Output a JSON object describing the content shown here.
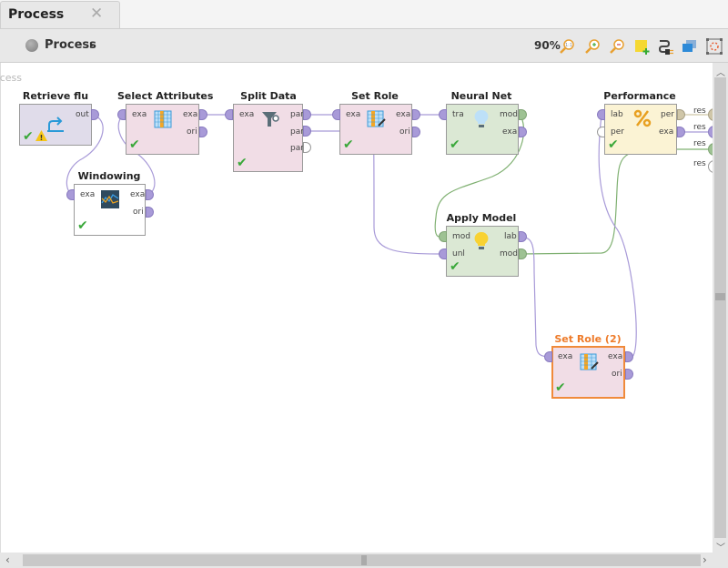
{
  "tab": {
    "label": "Process",
    "close_icon": "close-icon"
  },
  "toolbar": {
    "breadcrumb_icon": "process-icon",
    "breadcrumb_label": "Process",
    "breadcrumb_arrow": "▸",
    "zoom_level": "90%",
    "icons": [
      "zoom-reset-icon",
      "zoom-in-icon",
      "zoom-out-icon",
      "add-note-icon",
      "auto-wire-icon",
      "layers-icon",
      "auto-fit-icon"
    ]
  },
  "canvas": {
    "label": "Process"
  },
  "operators": [
    {
      "id": "retrieve",
      "title": "Retrieve flu",
      "color": "purple-gray",
      "inputs": [],
      "outputs": [
        "out"
      ],
      "status": "ok",
      "warning": true
    },
    {
      "id": "select",
      "title": "Select Attributes",
      "color": "pink",
      "inputs": [
        "exa"
      ],
      "outputs": [
        "exa",
        "ori"
      ],
      "status": "ok"
    },
    {
      "id": "split",
      "title": "Split Data",
      "color": "pink",
      "inputs": [
        "exa"
      ],
      "outputs": [
        "par",
        "par",
        "par"
      ],
      "status": "ok"
    },
    {
      "id": "setrole",
      "title": "Set Role",
      "color": "pink",
      "inputs": [
        "exa"
      ],
      "outputs": [
        "exa",
        "ori"
      ],
      "status": "ok"
    },
    {
      "id": "neural",
      "title": "Neural Net",
      "color": "green",
      "inputs": [
        "tra"
      ],
      "outputs": [
        "mod",
        "exa"
      ],
      "status": "ok"
    },
    {
      "id": "performance",
      "title": "Performance",
      "color": "yellow",
      "inputs": [
        "lab",
        "per"
      ],
      "outputs": [
        "per",
        "exa"
      ],
      "status": "ok"
    },
    {
      "id": "windowing",
      "title": "Windowing",
      "color": "white",
      "inputs": [
        "exa"
      ],
      "outputs": [
        "exa",
        "ori"
      ],
      "status": "ok"
    },
    {
      "id": "apply",
      "title": "Apply Model",
      "color": "green",
      "inputs": [
        "mod",
        "unl"
      ],
      "outputs": [
        "lab",
        "mod"
      ],
      "status": "ok"
    },
    {
      "id": "setrole2",
      "title": "Set Role (2)",
      "color": "pink",
      "inputs": [
        "exa"
      ],
      "outputs": [
        "exa",
        "ori"
      ],
      "status": "ok",
      "selected": true
    }
  ],
  "result_ports": [
    "res",
    "res",
    "res",
    "res"
  ],
  "status_icons": {
    "ok": "✔",
    "warning": "!"
  },
  "scrollbars": {
    "up": "^",
    "down": "v",
    "left": "<",
    "right": ">"
  }
}
